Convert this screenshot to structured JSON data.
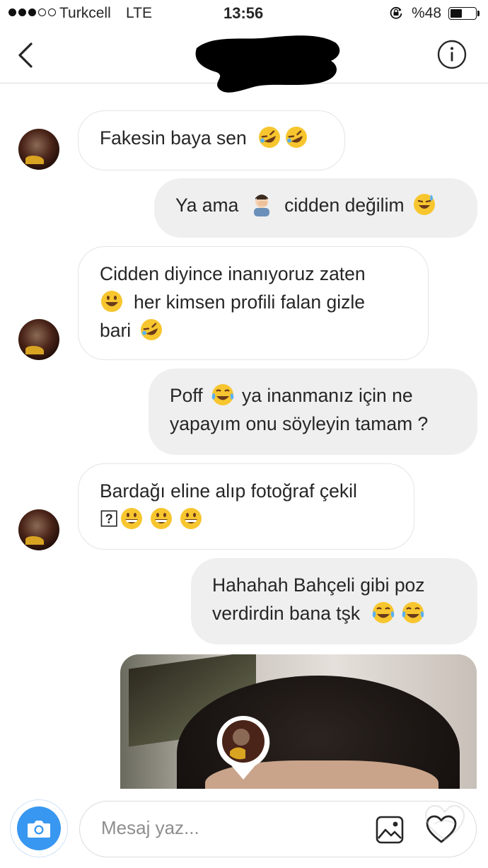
{
  "status_bar": {
    "carrier": "Turkcell",
    "network": "LTE",
    "time": "13:56",
    "battery": "%48",
    "battery_level": 0.48,
    "signal_bars": 3,
    "signal_total": 5
  },
  "header": {
    "back_icon": "chevron-left-icon",
    "title_censored": true,
    "info_icon": "info-icon"
  },
  "messages": [
    {
      "from": "them",
      "lines": [
        "Fakesin baya sen"
      ],
      "emoji": [
        "rofl",
        "rofl"
      ]
    },
    {
      "from": "me",
      "lines": [
        "Ya ama",
        "cidden değilim"
      ],
      "emoji": [
        "facepalm-man",
        "sweat-smile"
      ]
    },
    {
      "from": "them",
      "lines": [
        "Cidden diyince inanıyoruz zaten",
        "her kimsen profili falan gizle",
        "bari"
      ],
      "emoji": [
        "smiley",
        "rofl"
      ]
    },
    {
      "from": "me",
      "lines": [
        "Poff",
        "ya inanmanız için ne",
        "yapayım onu söyleyin tamam ?"
      ],
      "emoji": [
        "joy"
      ]
    },
    {
      "from": "them",
      "lines": [
        "Bardağı eline alıp fotoğraf çekil"
      ],
      "emoji": [
        "question-box",
        "grin",
        "grin",
        "grin"
      ]
    },
    {
      "from": "me",
      "lines": [
        "Hahahah Bahçeli gibi poz",
        "verdirdin bana tşk"
      ],
      "emoji": [
        "joy",
        "joy"
      ]
    }
  ],
  "composer": {
    "placeholder": "Mesaj yaz...",
    "camera_icon": "camera-icon",
    "gallery_icon": "gallery-icon",
    "heart_icon": "heart-icon"
  },
  "colors": {
    "accent": "#3897f0",
    "bubble_out": "#efefef",
    "bubble_in_border": "#e4e4e4",
    "divider": "#dbdbdb"
  }
}
